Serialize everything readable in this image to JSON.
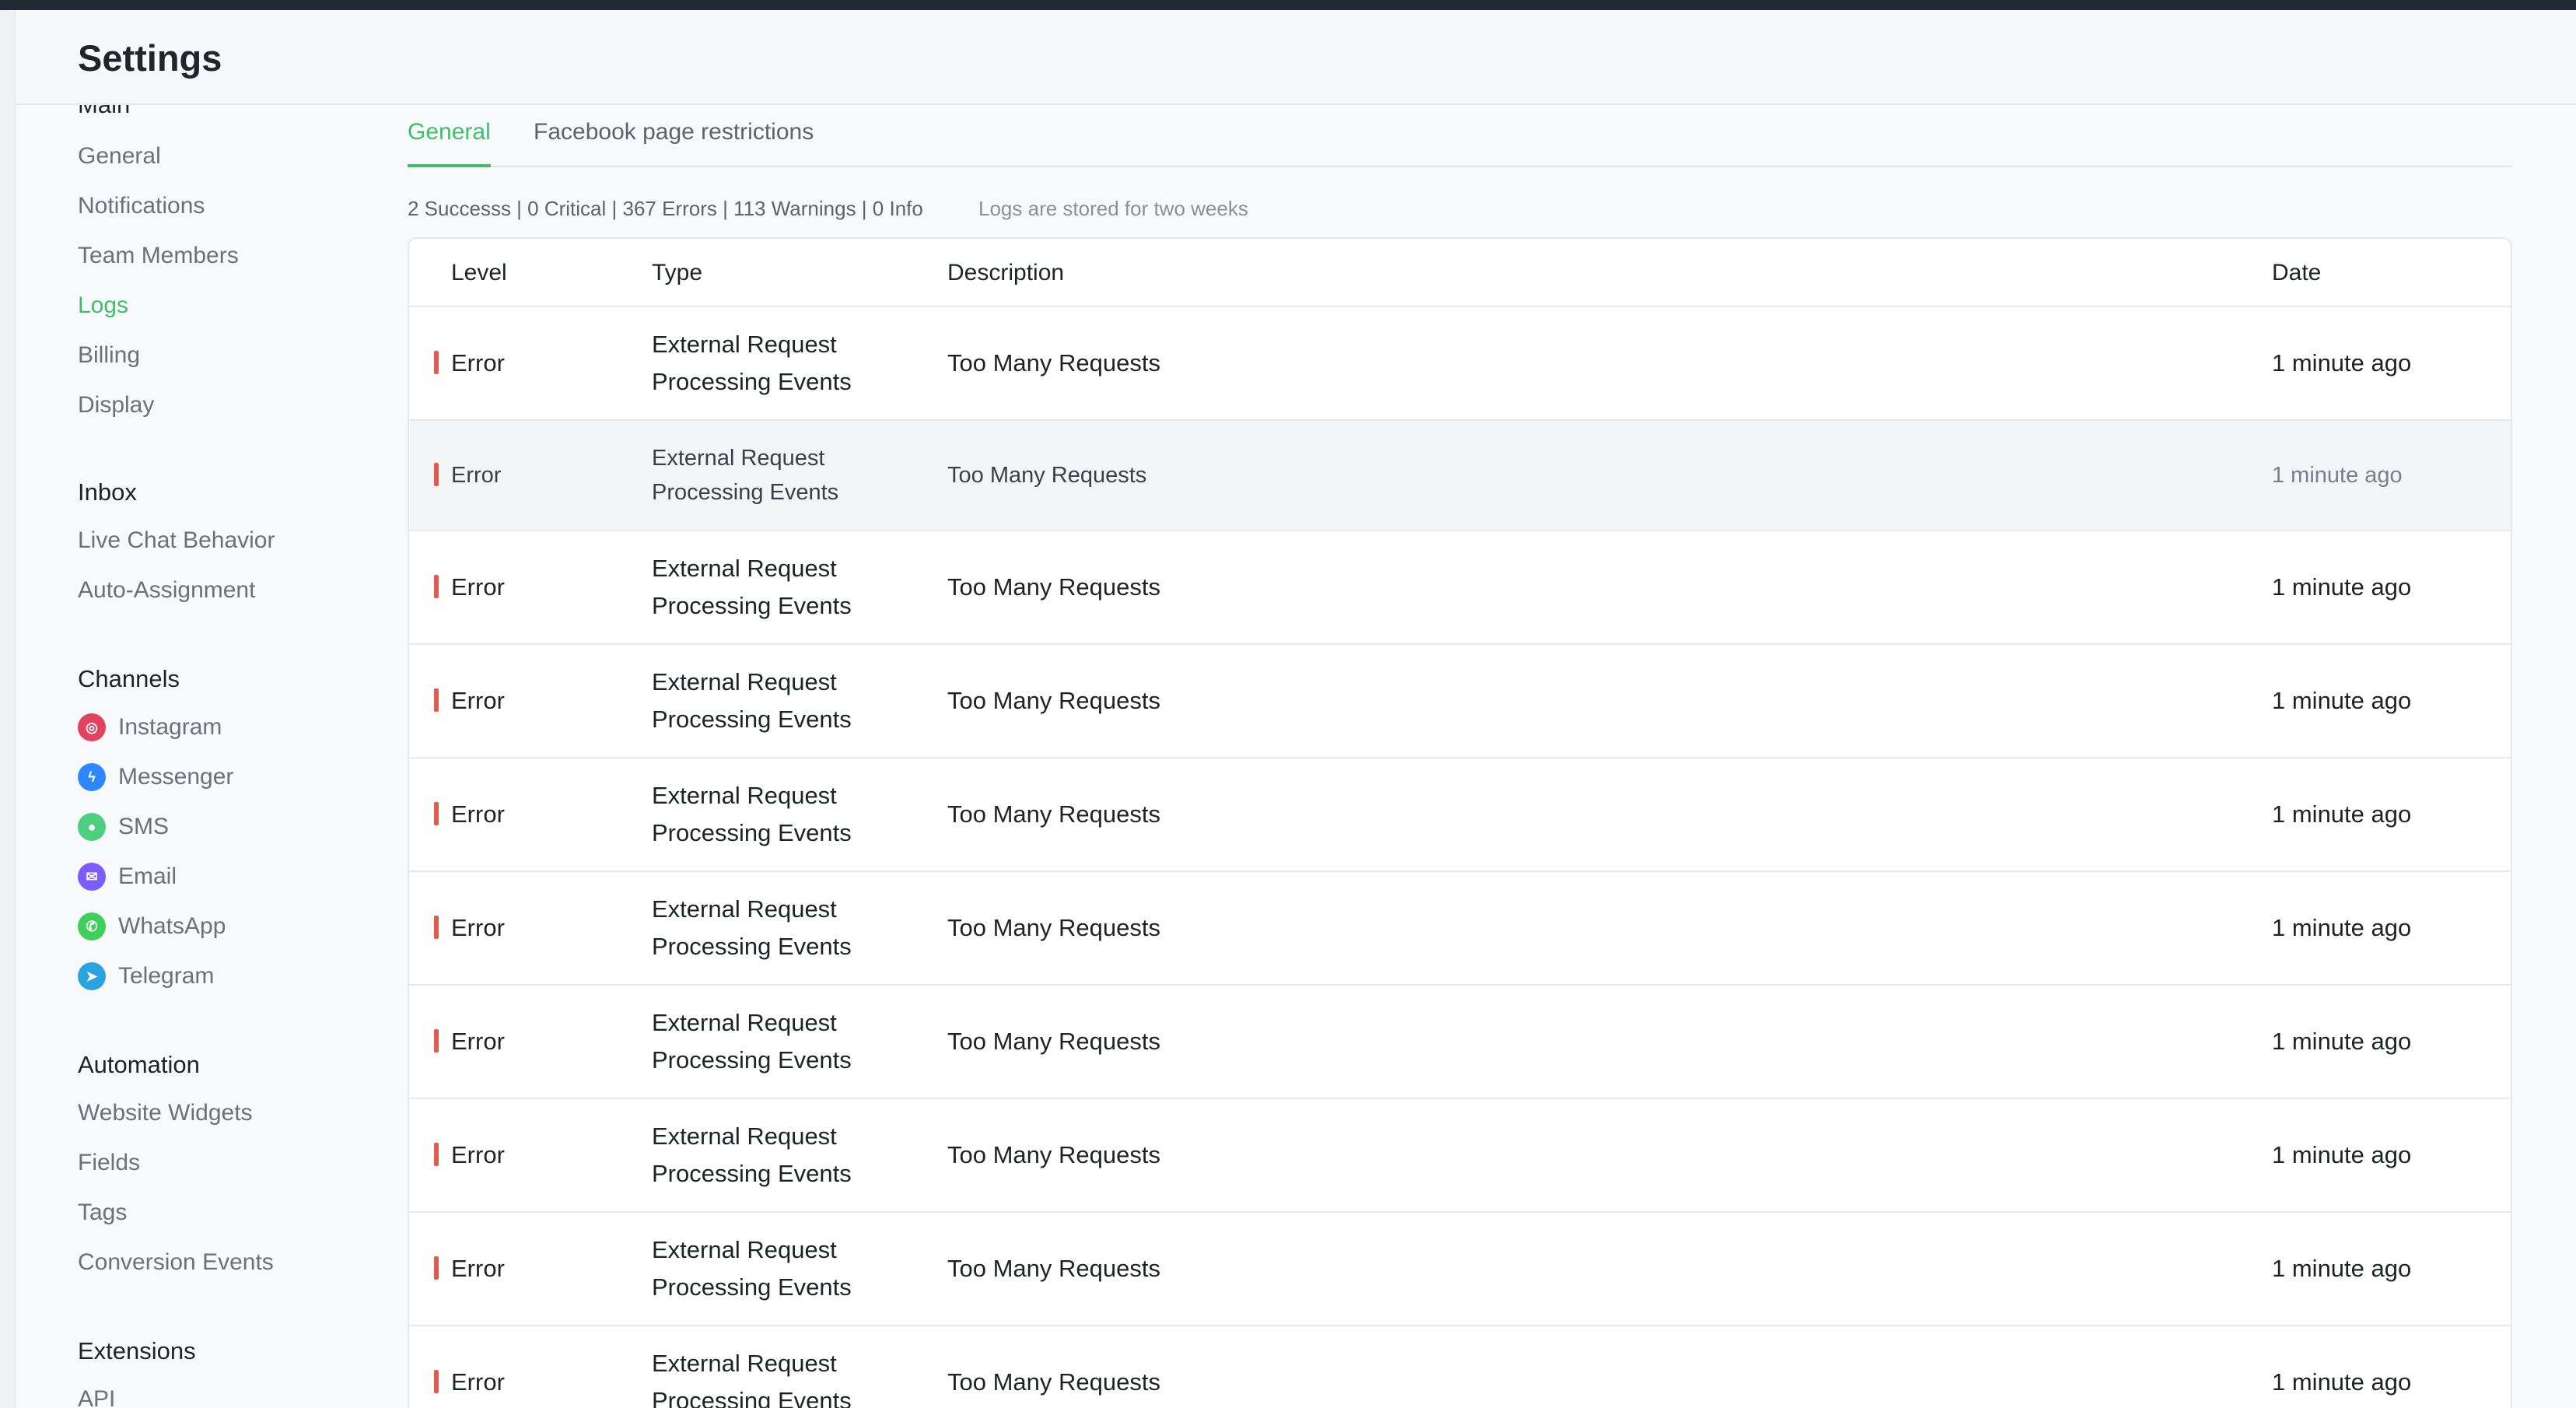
{
  "header": {
    "title": "Settings"
  },
  "sidebar": {
    "sections": [
      {
        "title": "Main",
        "items": [
          "General",
          "Notifications",
          "Team Members",
          "Logs",
          "Billing",
          "Display"
        ]
      },
      {
        "title": "Inbox",
        "items": [
          "Live Chat Behavior",
          "Auto-Assignment"
        ]
      },
      {
        "title": "Channels",
        "items": [
          "Instagram",
          "Messenger",
          "SMS",
          "Email",
          "WhatsApp",
          "Telegram"
        ]
      },
      {
        "title": "Automation",
        "items": [
          "Website Widgets",
          "Fields",
          "Tags",
          "Conversion Events"
        ]
      },
      {
        "title": "Extensions",
        "items": [
          "API"
        ]
      }
    ],
    "active_item": "Logs",
    "channel_icons": [
      {
        "name": "instagram-icon",
        "color": "#e4405f"
      },
      {
        "name": "messenger-icon",
        "color": "#2d88ff"
      },
      {
        "name": "sms-icon",
        "color": "#4cd080"
      },
      {
        "name": "email-icon",
        "color": "#7b5cff"
      },
      {
        "name": "whatsapp-icon",
        "color": "#3fcf5a"
      },
      {
        "name": "telegram-icon",
        "color": "#2aa3e0"
      }
    ]
  },
  "tabs": [
    "General",
    "Facebook page restrictions"
  ],
  "active_tab": "General",
  "summary": "2 Successs | 0 Critical | 367 Errors | 113 Warnings | 0 Info",
  "retention_note": "Logs are stored for two weeks",
  "table": {
    "headers": [
      "Level",
      "Type",
      "Description",
      "Date"
    ],
    "rows": [
      {
        "level": "Error",
        "type_line1": "External Request",
        "type_line2": "Processing Events",
        "description": "Too Many Requests",
        "date": "1 minute ago"
      },
      {
        "level": "Error",
        "type_line1": "External Request",
        "type_line2": "Processing Events",
        "description": "Too Many Requests",
        "date": "1 minute ago"
      },
      {
        "level": "Error",
        "type_line1": "External Request",
        "type_line2": "Processing Events",
        "description": "Too Many Requests",
        "date": "1 minute ago"
      },
      {
        "level": "Error",
        "type_line1": "External Request",
        "type_line2": "Processing Events",
        "description": "Too Many Requests",
        "date": "1 minute ago"
      },
      {
        "level": "Error",
        "type_line1": "External Request",
        "type_line2": "Processing Events",
        "description": "Too Many Requests",
        "date": "1 minute ago"
      },
      {
        "level": "Error",
        "type_line1": "External Request",
        "type_line2": "Processing Events",
        "description": "Too Many Requests",
        "date": "1 minute ago"
      },
      {
        "level": "Error",
        "type_line1": "External Request",
        "type_line2": "Processing Events",
        "description": "Too Many Requests",
        "date": "1 minute ago"
      },
      {
        "level": "Error",
        "type_line1": "External Request",
        "type_line2": "Processing Events",
        "description": "Too Many Requests",
        "date": "1 minute ago"
      },
      {
        "level": "Error",
        "type_line1": "External Request",
        "type_line2": "Processing Events",
        "description": "Too Many Requests",
        "date": "1 minute ago"
      },
      {
        "level": "Error",
        "type_line1": "External Request",
        "type_line2": "Processing Events",
        "description": "Too Many Requests",
        "date": "1 minute ago"
      }
    ],
    "error_color": "#e05b4b"
  },
  "colors": {
    "accent": "#3fbf6a",
    "topbar": "#232833"
  }
}
